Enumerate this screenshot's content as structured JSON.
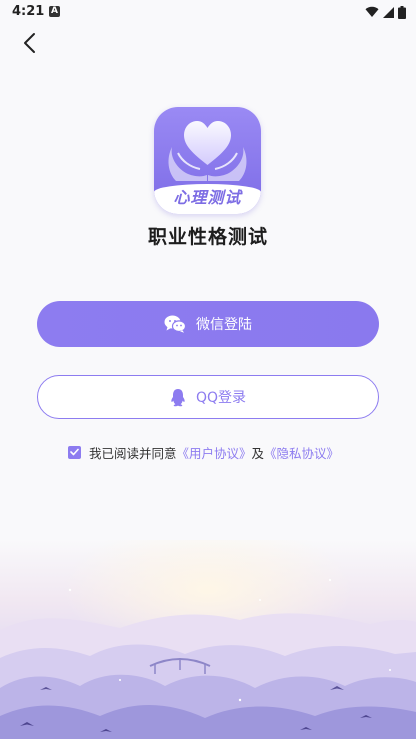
{
  "status_bar": {
    "time": "4:21",
    "notification_glyph": "A",
    "icons": [
      "wifi-icon",
      "cell-signal-icon",
      "battery-icon"
    ]
  },
  "nav": {
    "back_icon": "chevron-left-icon"
  },
  "app": {
    "icon_label": "心理测试",
    "name": "职业性格测试"
  },
  "login": {
    "wechat_label": "微信登陆",
    "wechat_icon": "wechat-icon",
    "qq_label": "QQ登录",
    "qq_icon": "qq-icon"
  },
  "agreement": {
    "checked": true,
    "prefix": "我已阅读并同意",
    "user_agreement": "《用户协议》",
    "conjunction": "及",
    "privacy_policy": "《隐私协议》"
  },
  "colors": {
    "accent": "#8d7cf0",
    "background": "#f9f9fb",
    "title_text": "#1d1d1d"
  }
}
